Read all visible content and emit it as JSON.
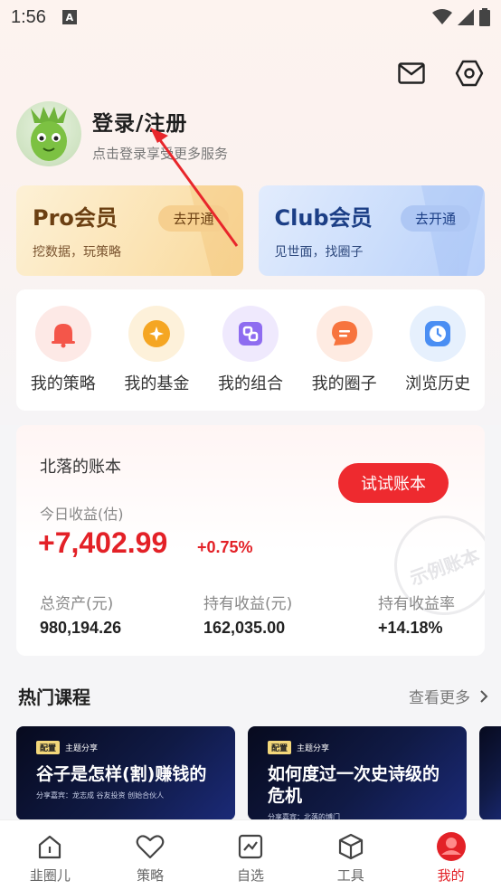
{
  "status_bar": {
    "time": "1:56",
    "badge": "A"
  },
  "profile": {
    "title": "登录/注册",
    "subtitle": "点击登录享受更多服务"
  },
  "members": [
    {
      "title": "Pro会员",
      "subtitle": "挖数据，玩策略",
      "button": "去开通"
    },
    {
      "title": "Club会员",
      "subtitle": "见世面，找圈子",
      "button": "去开通"
    }
  ],
  "shortcuts": [
    {
      "label": "我的策略",
      "icon": "bell-icon",
      "color": "#f4564a"
    },
    {
      "label": "我的基金",
      "icon": "fund-coin-icon",
      "color": "#f5a623"
    },
    {
      "label": "我的组合",
      "icon": "portfolio-icon",
      "color": "#8e6cf0"
    },
    {
      "label": "我的圈子",
      "icon": "chat-bubble-icon",
      "color": "#f7743e"
    },
    {
      "label": "浏览历史",
      "icon": "clock-icon",
      "color": "#4a8ef3"
    }
  ],
  "account": {
    "name": "北落的账本",
    "try_button": "试试账本",
    "today_label": "今日收益(估)",
    "today_value": "+7,402.99",
    "today_pct": "+0.75%",
    "stamp": "示例账本",
    "stats": [
      {
        "label": "总资产(元)",
        "value": "980,194.26"
      },
      {
        "label": "持有收益(元)",
        "value": "162,035.00"
      },
      {
        "label": "持有收益率",
        "value": "+14.18%"
      }
    ]
  },
  "courses": {
    "title": "热门课程",
    "more": "查看更多",
    "items": [
      {
        "tag": "配置",
        "topic": "主题分享",
        "title": "谷子是怎样(割)赚钱的",
        "guest": "分享嘉宾：龙志成 谷友投资 创始合伙人"
      },
      {
        "tag": "配置",
        "topic": "主题分享",
        "title": "如何度过一次史诗级的危机",
        "guest": "分享嘉宾：北落的博门"
      }
    ]
  },
  "tabs": [
    {
      "label": "韭圈儿",
      "icon": "home-icon"
    },
    {
      "label": "策略",
      "icon": "heart-icon"
    },
    {
      "label": "自选",
      "icon": "chart-icon"
    },
    {
      "label": "工具",
      "icon": "box-icon"
    },
    {
      "label": "我的",
      "icon": "profile-icon",
      "active": true
    }
  ],
  "colors": {
    "accent": "#e32127",
    "pro": "#6b3f12",
    "club": "#1c3f86"
  }
}
